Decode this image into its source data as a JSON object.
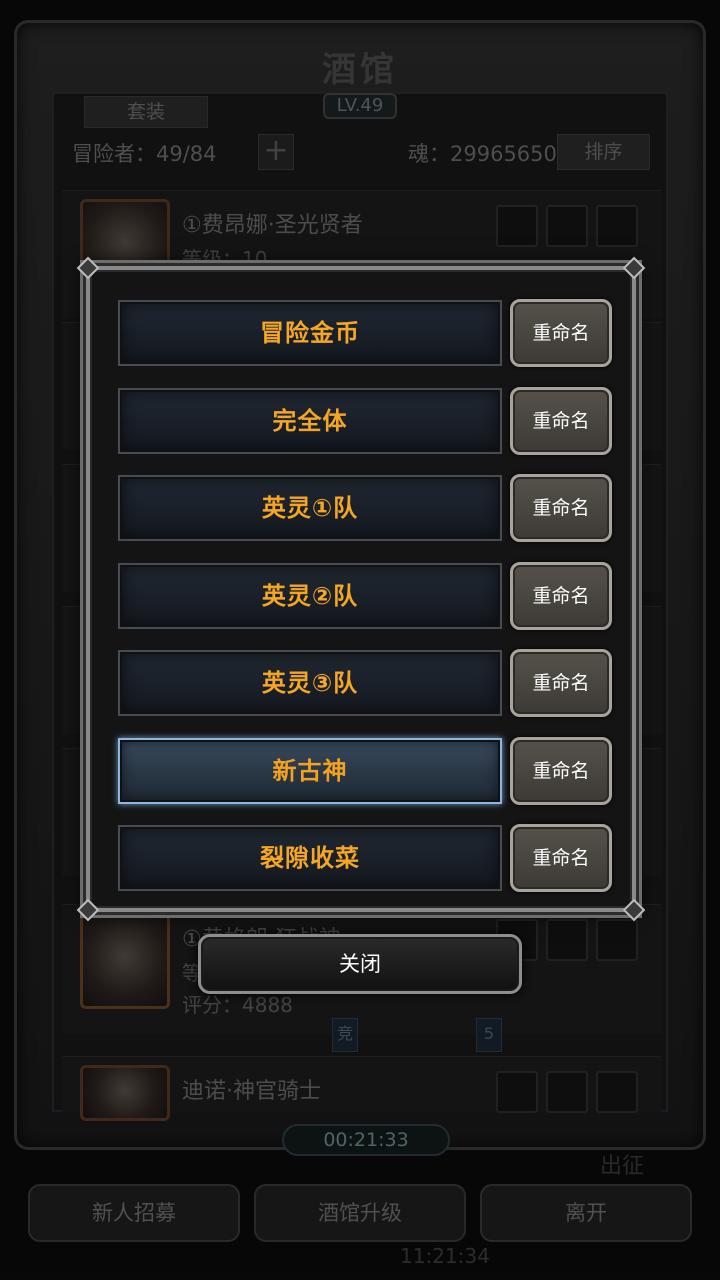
{
  "background": {
    "title": "酒馆",
    "level": "LV.49",
    "suit_label": "套装",
    "adventurer_count": "冒险者：49/84",
    "plus_label": "+",
    "soul": "魂：29965650",
    "sort_label": "排序",
    "rows": [
      {
        "name": "①费昂娜·圣光贤者",
        "level": "等级：10"
      },
      {
        "name": "",
        "level": ""
      },
      {
        "name": "",
        "level": ""
      },
      {
        "name": "",
        "level": ""
      },
      {
        "name": "",
        "level": ""
      },
      {
        "name": "①黄格朗·狂战神",
        "level": "等",
        "score": "评分：4888"
      },
      {
        "name": "迪诺·神官骑士",
        "level": ""
      }
    ],
    "tag_left": "竞",
    "tag_right": "5",
    "timer": "00:21:33",
    "deploy_label": "出征",
    "bottom_buttons": [
      "新人招募",
      "酒馆升级",
      "离开"
    ],
    "clock": "11:21:34"
  },
  "modal": {
    "teams": [
      {
        "name": "冒险金币",
        "active": false
      },
      {
        "name": "完全体",
        "active": false
      },
      {
        "name": "英灵①队",
        "active": false
      },
      {
        "name": "英灵②队",
        "active": false
      },
      {
        "name": "英灵③队",
        "active": false
      },
      {
        "name": "新古神",
        "active": true
      },
      {
        "name": "裂隙收菜",
        "active": false
      }
    ],
    "rename_label": "重命名",
    "close_label": "关闭"
  }
}
